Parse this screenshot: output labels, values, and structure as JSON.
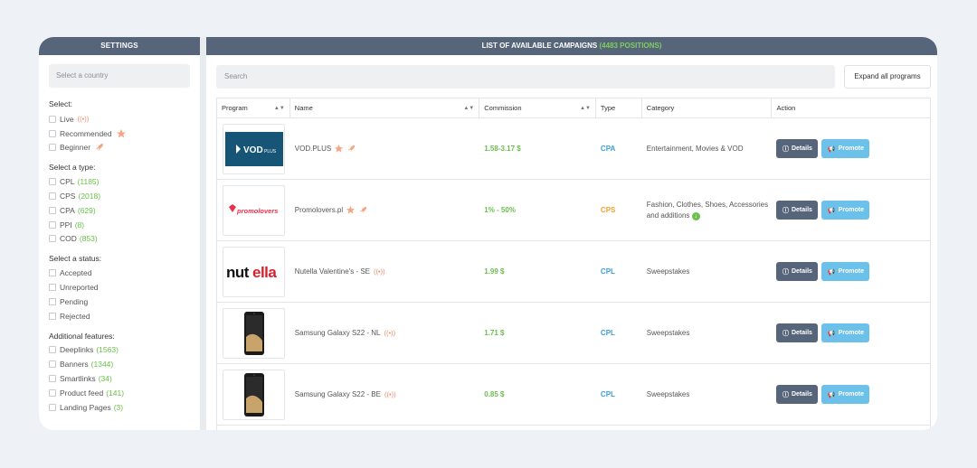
{
  "settings": {
    "title": "SETTINGS",
    "country_placeholder": "Select a country",
    "select": {
      "title": "Select:",
      "items": [
        "Live",
        "Recommended",
        "Beginner"
      ]
    },
    "type": {
      "title": "Select a type:",
      "items": [
        {
          "label": "CPL",
          "count": "(1185)"
        },
        {
          "label": "CPS",
          "count": "(2018)"
        },
        {
          "label": "CPA",
          "count": "(629)"
        },
        {
          "label": "PPI",
          "count": "(8)"
        },
        {
          "label": "COD",
          "count": "(853)"
        }
      ]
    },
    "status": {
      "title": "Select a status:",
      "items": [
        "Accepted",
        "Unreported",
        "Pending",
        "Rejected"
      ]
    },
    "features": {
      "title": "Additional features:",
      "items": [
        {
          "label": "Deeplinks",
          "count": "(1563)"
        },
        {
          "label": "Banners",
          "count": "(1344)"
        },
        {
          "label": "Smartlinks",
          "count": "(34)"
        },
        {
          "label": "Product feed",
          "count": "(141)"
        },
        {
          "label": "Landing Pages",
          "count": "(3)"
        }
      ]
    }
  },
  "main": {
    "title": "LIST OF AVAILABLE CAMPAIGNS",
    "count": "(4483 POSITIONS)",
    "search_placeholder": "Search",
    "expand_label": "Expand all programs",
    "columns": [
      "Program",
      "Name",
      "Commission",
      "Type",
      "Category",
      "Action"
    ],
    "details_label": "Details",
    "promote_label": "Promote",
    "rows": [
      {
        "logo": "VOD.PLUS",
        "name": "VOD.PLUS",
        "commission": "1.58-3.17 $",
        "type": "CPA",
        "category": "Entertainment, Movies & VOD",
        "live": ""
      },
      {
        "logo": "promolovers",
        "name": "Promolovers.pl",
        "commission": "1% - 50%",
        "type": "CPS",
        "category": "Fashion, Clothes, Shoes, Accessories and additions",
        "live": ""
      },
      {
        "logo": "nutella",
        "name": "Nutella Valentine's - SE",
        "commission": "1.99 $",
        "type": "CPL",
        "category": "Sweepstakes",
        "live": "((•))"
      },
      {
        "logo": "samsung",
        "name": "Samsung Galaxy S22 - NL",
        "commission": "1.71 $",
        "type": "CPL",
        "category": "Sweepstakes",
        "live": "((•))"
      },
      {
        "logo": "samsung",
        "name": "Samsung Galaxy S22 - BE",
        "commission": "0.85 $",
        "type": "CPL",
        "category": "Sweepstakes",
        "live": "((•))"
      }
    ]
  },
  "colors": {
    "header": "#56657a",
    "count_green": "#6abf4b",
    "cpa_blue": "#3ba0d8",
    "cps_orange": "#f0a12a",
    "promote": "#6cc1ea",
    "badge": "#f28a6a"
  }
}
